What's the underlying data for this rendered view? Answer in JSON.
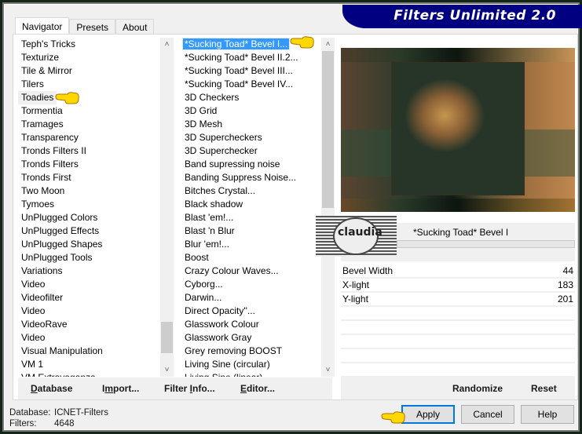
{
  "window": {
    "title": "Filters Unlimited 2.0"
  },
  "tabs": [
    {
      "label": "Navigator",
      "active": true
    },
    {
      "label": "Presets",
      "active": false
    },
    {
      "label": "About",
      "active": false
    }
  ],
  "categories": {
    "hovered": "Toadies",
    "items": [
      "Teph's Tricks",
      "Texturize",
      "Tile & Mirror",
      "Tilers",
      "Toadies",
      "Tormentia",
      "Tramages",
      "Transparency",
      "Tronds Filters II",
      "Tronds Filters",
      "Tronds First",
      "Two Moon",
      "Tymoes",
      "UnPlugged Colors",
      "UnPlugged Effects",
      "UnPlugged Shapes",
      "UnPlugged Tools",
      "Variations",
      "Video",
      "Videofilter",
      "Video",
      "VideoRave",
      "Video",
      "Visual Manipulation",
      "VM 1",
      "VM Extravaganza"
    ]
  },
  "filters": {
    "selected": "*Sucking Toad*  Bevel I...",
    "items": [
      "*Sucking Toad*  Bevel I...",
      "*Sucking Toad*  Bevel II.2...",
      "*Sucking Toad*  Bevel III...",
      "*Sucking Toad*  Bevel IV...",
      "3D Checkers",
      "3D Grid",
      "3D Mesh",
      "3D Supercheckers",
      "3D Superchecker",
      "Band supressing noise",
      "Banding Suppress Noise...",
      "Bitches Crystal...",
      "Black shadow",
      "Blast 'em!...",
      "Blast 'n Blur",
      "Blur 'em!...",
      "Boost",
      "Crazy Colour Waves...",
      "Cyborg...",
      "Darwin...",
      "Direct Opacity''...",
      "Glasswork Colour",
      "Glasswork Gray",
      "Grey removing BOOST",
      "Living Sine (circular)",
      "Living Sine (linear)"
    ]
  },
  "preview": {
    "logo_text": "claudia",
    "filter_name": "*Sucking Toad*  Bevel I"
  },
  "parameters": [
    {
      "label": "Bevel Width",
      "value": "44"
    },
    {
      "label": "X-light",
      "value": "183"
    },
    {
      "label": "Y-light",
      "value": "201"
    }
  ],
  "toolbar_left": {
    "database": {
      "pre": "",
      "u": "D",
      "post": "atabase"
    },
    "import": {
      "pre": "I",
      "u": "m",
      "post": "port..."
    },
    "filter_info": {
      "pre": "Filter ",
      "u": "I",
      "post": "nfo..."
    },
    "editor": {
      "pre": "",
      "u": "E",
      "post": "ditor..."
    }
  },
  "toolbar_right": {
    "randomize": "Randomize",
    "reset": "Reset"
  },
  "status": {
    "database_label": "Database:",
    "database_value": "ICNET-Filters",
    "filters_label": "Filters:",
    "filters_value": "4648"
  },
  "buttons": {
    "apply": "Apply",
    "cancel": "Cancel",
    "help": "Help"
  },
  "colors": {
    "title_bg": "#000080",
    "selection": "#3399ff",
    "default_button_border": "#0078d7"
  }
}
